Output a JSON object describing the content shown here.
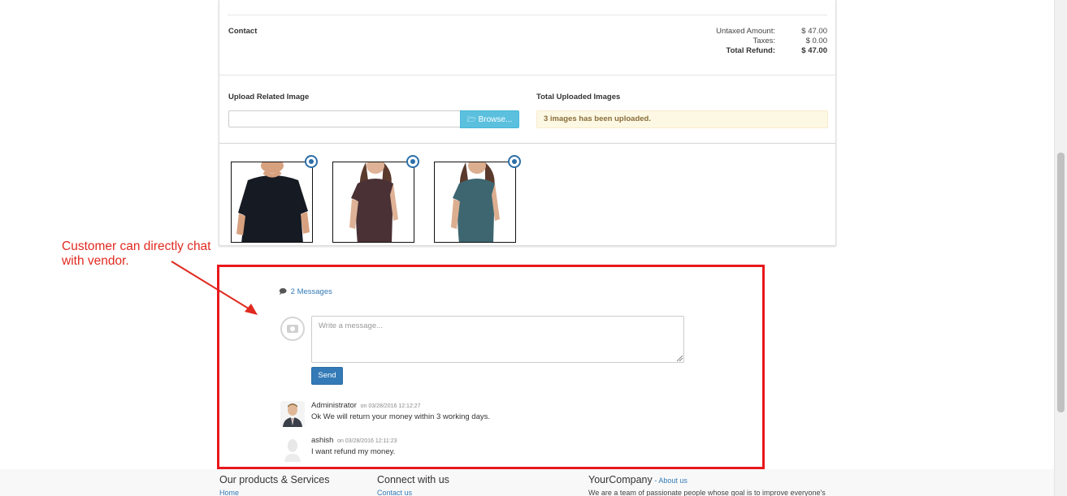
{
  "contact": {
    "label": "Contact"
  },
  "totals": {
    "untaxed_label": "Untaxed Amount:",
    "untaxed_value": "$ 47.00",
    "taxes_label": "Taxes:",
    "taxes_value": "$ 0.00",
    "total_label": "Total Refund:",
    "total_value": "$ 47.00"
  },
  "upload": {
    "label": "Upload Related Image",
    "input_value": "",
    "browse_label": "Browse...",
    "browse_icon": "folder-open-icon"
  },
  "uploaded": {
    "label": "Total Uploaded Images",
    "status": "3 images has been uploaded."
  },
  "images": [
    {
      "name": "black-tshirt-image",
      "color": "#161a22",
      "skin": "#d7a17f"
    },
    {
      "name": "brown-tshirt-image",
      "color": "#4a3136",
      "skin": "#dfb297"
    },
    {
      "name": "teal-tshirt-image",
      "color": "#3d6670",
      "skin": "#dcae90"
    }
  ],
  "annotation": {
    "line1": "Customer can directly chat",
    "line2": "with vendor.",
    "color": "#e02a20"
  },
  "chatter": {
    "count_label": "2 Messages",
    "count_icon": "comment-icon",
    "placeholder": "Write a message...",
    "send_label": "Send",
    "messages": [
      {
        "author": "Administrator",
        "date": "on 03/28/2016 12:12:27",
        "body": "Ok We will return your money within 3 working days."
      },
      {
        "author": "ashish",
        "date": "on 03/28/2016 12:11:23",
        "body": "I want refund my money."
      }
    ]
  },
  "footer": {
    "col1_title": "Our products & Services",
    "col1_link": "Home",
    "col2_title": "Connect with us",
    "col2_link": "Contact us",
    "col3_title": "YourCompany",
    "col3_sub": "- About us",
    "col3_text": "We are a team of passionate people whose goal is to improve everyone's"
  },
  "colors": {
    "primary": "#337ab7",
    "info": "#5bc0de",
    "warning_bg": "#fcf8e3",
    "warning_text": "#8a6d3b",
    "highlight": "#e8181d"
  }
}
